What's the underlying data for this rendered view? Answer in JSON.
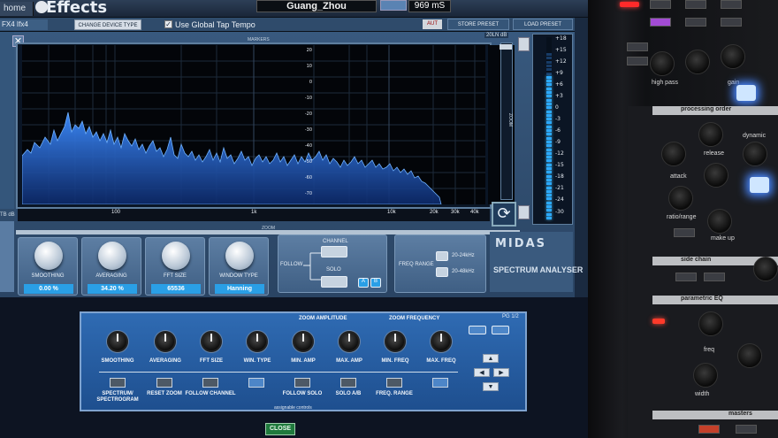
{
  "topbar": {
    "home_label": "home",
    "app_title": "Effects",
    "user_name": "Guang_Zhou",
    "delay_value": "969 mS"
  },
  "toolbar": {
    "slot_label": "FX4  Ifx4",
    "change_device_label": "CHANGE DEVICE TYPE",
    "tap_tempo_label": "Use Global Tap Tempo",
    "aut_label": "AUT",
    "store_preset_label": "STORE PRESET",
    "recall_preset_label": "LOAD PRESET"
  },
  "graph": {
    "markers_label": "MARKERS",
    "db_label": "20LN dB",
    "zoom_vertical_label": "ZOOM",
    "zoom_horizontal_label": "ZOOM",
    "scale_ticks": [
      "20",
      "10",
      "0",
      "-10",
      "-20",
      "-30",
      "-40",
      "-50",
      "-60",
      "-70"
    ],
    "freq_ticks": [
      "100",
      "1k",
      "10k",
      "20k",
      "30k",
      "40k"
    ],
    "left_edge_label": "TB dB",
    "line_color": "#3b8cff"
  },
  "meter": {
    "ticks": [
      "+18",
      "+15",
      "+12",
      "+9",
      "+6",
      "+3",
      "0",
      "-3",
      "-6",
      "-9",
      "-12",
      "-15",
      "-18",
      "-21",
      "-24",
      "-30"
    ]
  },
  "controls": {
    "smoothing": {
      "label": "SMOOTHING",
      "value": "0.00 %"
    },
    "averaging": {
      "label": "AVERAGING",
      "value": "34.20 %"
    },
    "fft_size": {
      "label": "FFT SIZE",
      "value": "65536"
    },
    "window_type": {
      "label": "WINDOW TYPE",
      "value": "Hanning"
    }
  },
  "follow": {
    "follow_label": "FOLLOW",
    "channel_label": "CHANNEL",
    "solo_label": "SOLO",
    "a_label": "A",
    "b_label": "B"
  },
  "freq_range": {
    "label": "FREQ RANGE",
    "opt1": "20-24kHz",
    "opt2": "20-48kHz"
  },
  "logo": {
    "brand": "MIDAS",
    "product": "SPECTRUM ANALYSER"
  },
  "assign_panel": {
    "zoom_amplitude": "ZOOM AMPLITUDE",
    "zoom_frequency": "ZOOM FREQUENCY",
    "page": "PG 1/2",
    "knobs": [
      "SMOOTHING",
      "AVERAGING",
      "FFT SIZE",
      "WIN. TYPE",
      "MIN. AMP",
      "MAX. AMP",
      "MIN. FREQ",
      "MAX. FREQ"
    ],
    "buttons": [
      "SPECTRUM/ SPECTROGRAM",
      "RESET ZOOM",
      "FOLLOW CHANNEL",
      "",
      "FOLLOW SOLO",
      "SOLO A/B",
      "FREQ. RANGE",
      ""
    ],
    "assignable_label": "assignable controls"
  },
  "close_label": "CLOSE",
  "hardware": {
    "processing_order": "processing order",
    "dynamic": "dynamic",
    "side_chain": "side chain",
    "parametric_eq": "parametric EQ",
    "masters": "masters",
    "release": "release",
    "attack": "attack",
    "ratio_range": "ratio/range",
    "make_up": "make up",
    "freq": "freq",
    "width": "width",
    "high_pass": "high pass",
    "gain": "gain"
  }
}
